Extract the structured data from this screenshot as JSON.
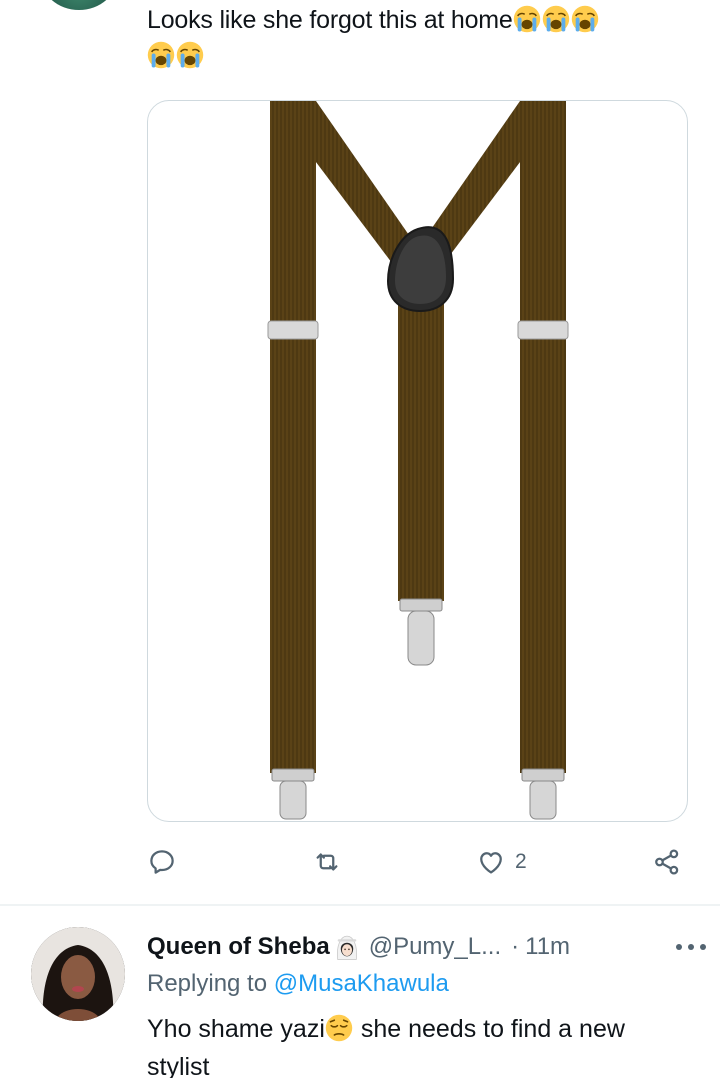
{
  "tweet": {
    "text": "Looks like she forgot this at home",
    "emoji": [
      "loudly-crying-face",
      "loudly-crying-face",
      "loudly-crying-face",
      "loudly-crying-face",
      "loudly-crying-face"
    ],
    "image_description_icon": "suspenders-image",
    "actions": {
      "reply_count": "",
      "retweet_count": "",
      "like_count": "2"
    }
  },
  "reply": {
    "display_name": "Queen of Sheba",
    "name_emoji": "woman-with-veil",
    "handle": "@Pumy_L...",
    "separator": "·",
    "time": "11m",
    "replying_prefix": "Replying to",
    "replying_to": "@MusaKhawula",
    "text_before_emoji": "Yho shame yazi",
    "text_emoji": "pensive-face",
    "text_after_emoji": " she needs to find a new stylist"
  },
  "colors": {
    "text": "#0f1419",
    "secondary": "#536471",
    "link": "#1d9bf0",
    "border": "#cfd9de",
    "suspender_brown": "#5a4216"
  }
}
